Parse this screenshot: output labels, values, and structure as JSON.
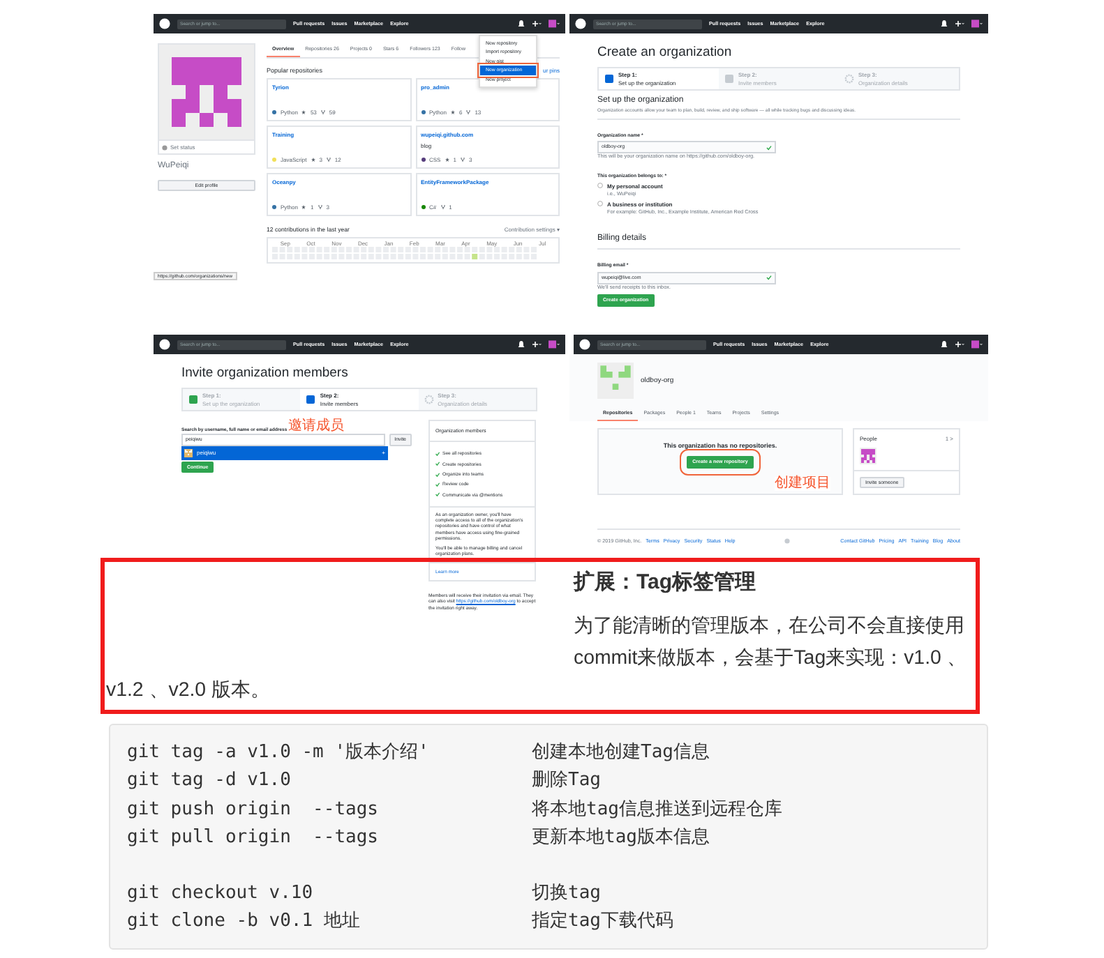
{
  "figure": {
    "panels": [
      {
        "kind": "profile",
        "nav": {
          "search": "Search or jump to...",
          "links": [
            "Pull requests",
            "Issues",
            "Marketplace",
            "Explore"
          ]
        },
        "menu": [
          {
            "label": "New repository",
            "selected": false
          },
          {
            "label": "Import repository",
            "selected": false
          },
          {
            "label": "New gist",
            "selected": false
          },
          {
            "label": "New organization",
            "selected": true
          },
          {
            "label": "New project",
            "selected": false
          }
        ],
        "user": {
          "status": "Set status",
          "name": "WuPeiqi",
          "button": "Edit profile"
        },
        "tabs": [
          {
            "label": "Overview",
            "selected": true
          },
          {
            "label": "Repositories",
            "count": "26",
            "selected": false
          },
          {
            "label": "Projects",
            "count": "0",
            "selected": false
          },
          {
            "label": "Stars",
            "count": "6",
            "selected": false
          },
          {
            "label": "Followers",
            "count": "123",
            "selected": false
          },
          {
            "label": "Follow",
            "selected": false
          }
        ],
        "section": "Popular repositories",
        "customize": "ur pins",
        "repos": [
          {
            "name": "Tyrion",
            "language": "Python",
            "color": "#3572a5",
            "stars": "53",
            "forks": "59"
          },
          {
            "name": "pro_admin",
            "language": "Python",
            "color": "#3572a5",
            "stars": "6",
            "forks": "13"
          },
          {
            "name": "Training",
            "language": "JavaScript",
            "color": "#f1e05a",
            "stars": "3",
            "forks": "12"
          },
          {
            "name": "wupeiqi.github.com",
            "description": "blog",
            "language": "CSS",
            "color": "#563d7c",
            "stars": "1",
            "forks": "3"
          },
          {
            "name": "Oceanpy",
            "language": "Python",
            "color": "#3572a5",
            "stars": "1",
            "forks": "3"
          },
          {
            "name": "EntityFrameworkPackage",
            "language": "C#",
            "color": "#178600",
            "forks": "1"
          }
        ],
        "contributions": "12 contributions in the last year",
        "settings": "Contribution settings ▾",
        "months": [
          "Sep",
          "Oct",
          "Nov",
          "Dec",
          "Jan",
          "Feb",
          "Mar",
          "Apr",
          "May",
          "Jun",
          "Jul"
        ],
        "status_url": "https://github.com/organizations/new"
      },
      {
        "kind": "create",
        "nav": {
          "search": "Search or jump to...",
          "links": [
            "Pull requests",
            "Issues",
            "Marketplace",
            "Explore"
          ]
        },
        "title": "Create an organization",
        "steps": [
          {
            "title": "Step 1:",
            "subtitle": "Set up the organization",
            "selected": true
          },
          {
            "title": "Step 2:",
            "subtitle": "Invite members",
            "selected": false
          },
          {
            "title": "Step 3:",
            "subtitle": "Organization details",
            "selected": false
          }
        ],
        "section": "Set up the organization",
        "description": "Organization accounts allow your team to plan, build, review, and ship software — all while tracking bugs and discussing ideas.",
        "name_label": "Organization name *",
        "name_value": "oldboy-org",
        "name_hint": "This will be your organization name on https://github.com/oldboy-org.",
        "belongs_label": "This organization belongs to: *",
        "options": [
          {
            "label": "My personal account",
            "sub": "i.e., WuPeiqi",
            "selected": false
          },
          {
            "label": "A business or institution",
            "sub": "For example: GitHub, Inc., Example Institute, American Red Cross",
            "selected": false
          }
        ],
        "billing": "Billing details",
        "email_label": "Billing email *",
        "email_value": "wupeiqi@live.com",
        "email_hint": "We'll send receipts to this inbox.",
        "button": "Create organization"
      },
      {
        "kind": "invite",
        "nav": {
          "search": "Search or jump to...",
          "links": [
            "Pull requests",
            "Issues",
            "Marketplace",
            "Explore"
          ]
        },
        "title": "Invite organization members",
        "steps": [
          {
            "title": "Step 1:",
            "subtitle": "Set up the organization",
            "selected": false
          },
          {
            "title": "Step 2:",
            "subtitle": "Invite members",
            "selected": true
          },
          {
            "title": "Step 3:",
            "subtitle": "Organization details",
            "selected": false
          }
        ],
        "search_label": "Search by username, full name or email address",
        "annotation": "邀请成员",
        "search_value": "peiqiwu",
        "invite": "Invite",
        "suggestion": "peiqiwu",
        "add": "+",
        "continue": "Continue",
        "members_title": "Organization members",
        "perks": [
          "See all repositories",
          "Create repositories",
          "Organize into teams",
          "Review code",
          "Communicate via @mentions"
        ],
        "owner_text": "As an organization owner, you'll have complete access to all of the organization's repositories and have control of what members have access using fine-grained permissions.",
        "plans_text": "You'll be able to manage billing and cancel organization plans.",
        "learn": "Learn more",
        "note": "Members will receive their invitation via email. They can also visit",
        "note_link": "https://github.com/oldboy-org",
        "note_end": "to accept the invitation right away."
      },
      {
        "kind": "org",
        "nav": {
          "search": "Search or jump to...",
          "links": [
            "Pull requests",
            "Issues",
            "Marketplace",
            "Explore"
          ]
        },
        "org_name": "oldboy-org",
        "tabs": [
          {
            "label": "Repositories",
            "selected": true
          },
          {
            "label": "Packages",
            "selected": false
          },
          {
            "label": "People",
            "count": "1",
            "selected": false
          },
          {
            "label": "Teams",
            "selected": false
          },
          {
            "label": "Projects",
            "selected": false
          },
          {
            "label": "Settings",
            "selected": false
          }
        ],
        "empty": "This organization has no repositories.",
        "button": "Create a new repository",
        "annotation": "创建项目",
        "people": "People",
        "people_count": "1 >",
        "invite": "Invite someone",
        "copyright": "© 2019 GitHub, Inc.",
        "footer_left": [
          "Terms",
          "Privacy",
          "Security",
          "Status",
          "Help"
        ],
        "footer_right": [
          "Contact GitHub",
          "Pricing",
          "API",
          "Training",
          "Blog",
          "About"
        ]
      }
    ]
  },
  "heading": "扩展：Tag标签管理",
  "paragraph": "为了能清晰的管理版本，在公司不会直接使用commit来做版本，会基于Tag来实现：v1.0 、v1.2 、v2.0 版本。",
  "code_block": {
    "groups": [
      [
        {
          "command": "git tag -a v1.0 -m '版本介绍'",
          "comment": "创建本地创建Tag信息"
        },
        {
          "command": "git tag -d v1.0",
          "comment": "删除Tag"
        },
        {
          "command": "git push origin  --tags",
          "comment": "将本地tag信息推送到远程仓库"
        },
        {
          "command": "git pull origin  --tags",
          "comment": "更新本地tag版本信息"
        }
      ],
      [
        {
          "command": "git checkout v.10",
          "comment": "切换tag"
        },
        {
          "command": "git clone -b v0.1 地址",
          "comment": "指定tag下载代码"
        }
      ]
    ]
  }
}
